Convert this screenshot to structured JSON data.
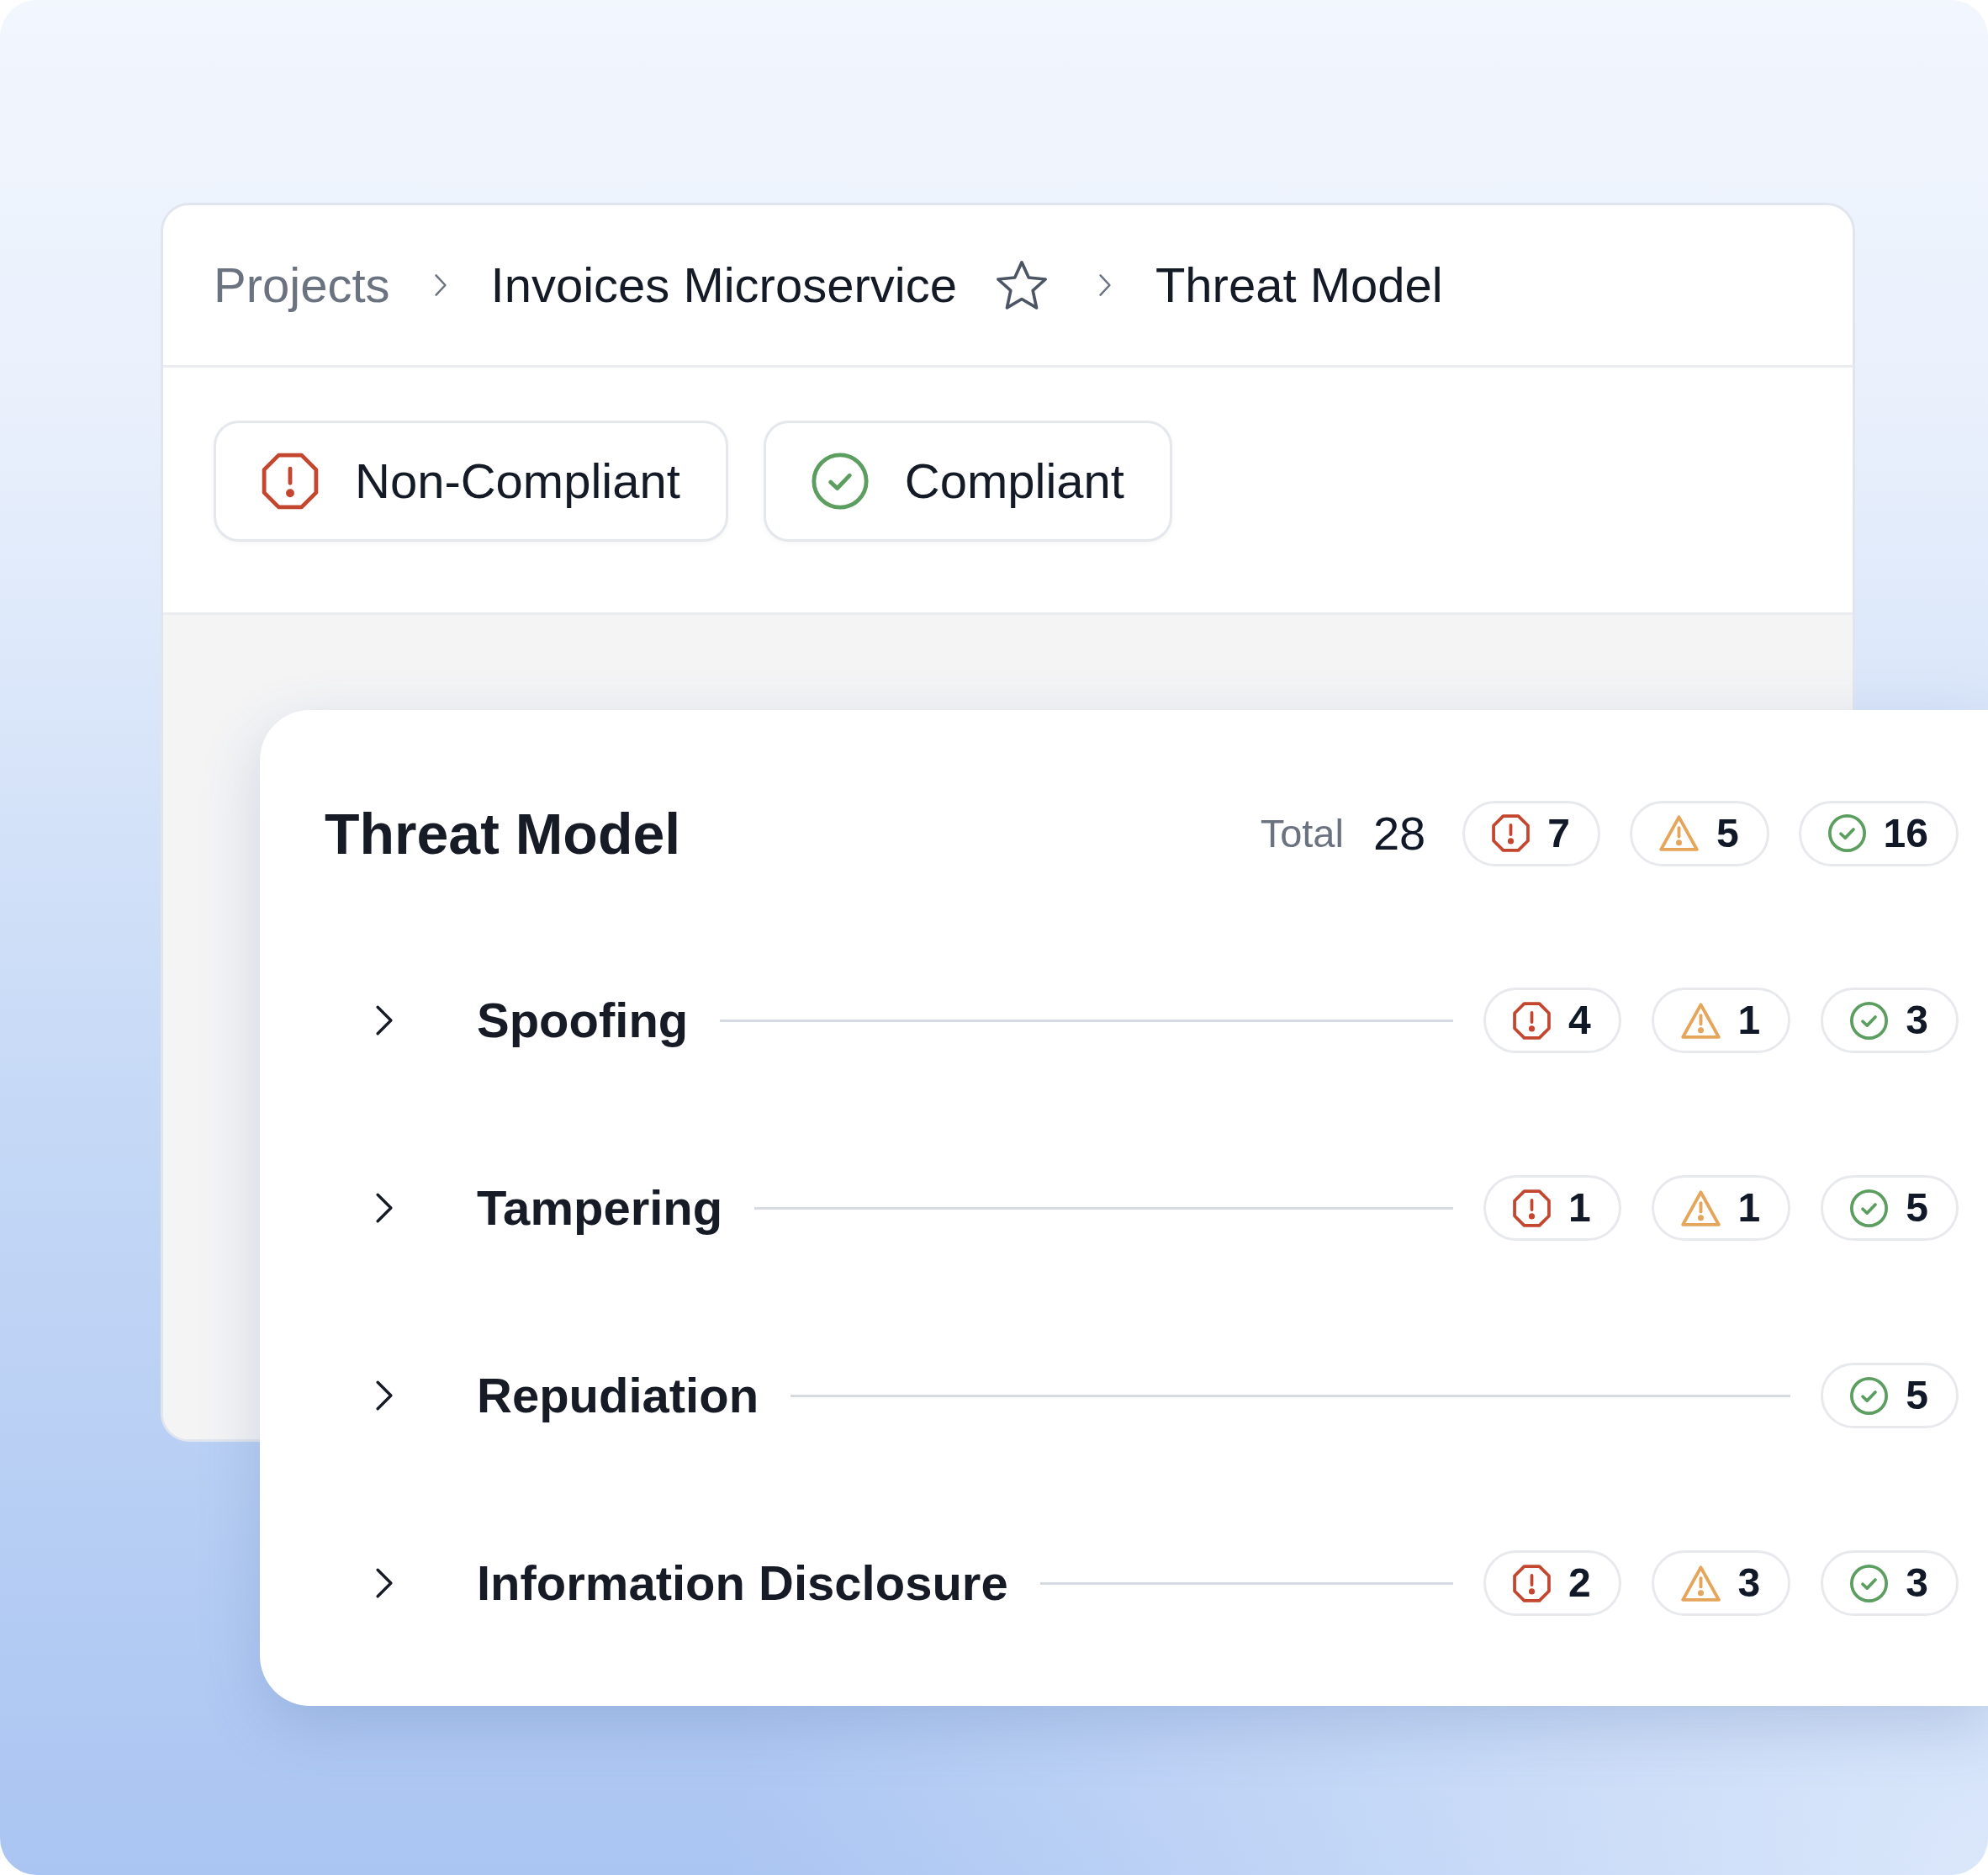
{
  "breadcrumb": [
    {
      "kind": "crumb",
      "label": "Projects",
      "muted": true
    },
    {
      "kind": "crumb",
      "label": "Invoices Microservice",
      "muted": false
    },
    {
      "kind": "favorite",
      "starred": false
    },
    {
      "kind": "crumb",
      "label": "Threat Model",
      "muted": false
    }
  ],
  "filters": [
    {
      "kind": "critical",
      "label": "Non-Compliant"
    },
    {
      "kind": "passed",
      "label": "Compliant"
    }
  ],
  "threat_model": {
    "title": "Threat Model",
    "total_label": "Total",
    "total": "28",
    "counts": [
      {
        "kind": "critical",
        "value": "7"
      },
      {
        "kind": "warning",
        "value": "5"
      },
      {
        "kind": "passed",
        "value": "16"
      }
    ],
    "categories": [
      {
        "name": "Spoofing",
        "expanded": false,
        "counts": [
          {
            "kind": "critical",
            "value": "4"
          },
          {
            "kind": "warning",
            "value": "1"
          },
          {
            "kind": "passed",
            "value": "3"
          }
        ]
      },
      {
        "name": "Tampering",
        "expanded": false,
        "counts": [
          {
            "kind": "critical",
            "value": "1"
          },
          {
            "kind": "warning",
            "value": "1"
          },
          {
            "kind": "passed",
            "value": "5"
          }
        ]
      },
      {
        "name": "Repudiation",
        "expanded": false,
        "counts": [
          {
            "kind": "passed",
            "value": "5"
          }
        ]
      },
      {
        "name": "Information Disclosure",
        "expanded": false,
        "counts": [
          {
            "kind": "critical",
            "value": "2"
          },
          {
            "kind": "warning",
            "value": "3"
          },
          {
            "kind": "passed",
            "value": "3"
          }
        ]
      }
    ]
  }
}
